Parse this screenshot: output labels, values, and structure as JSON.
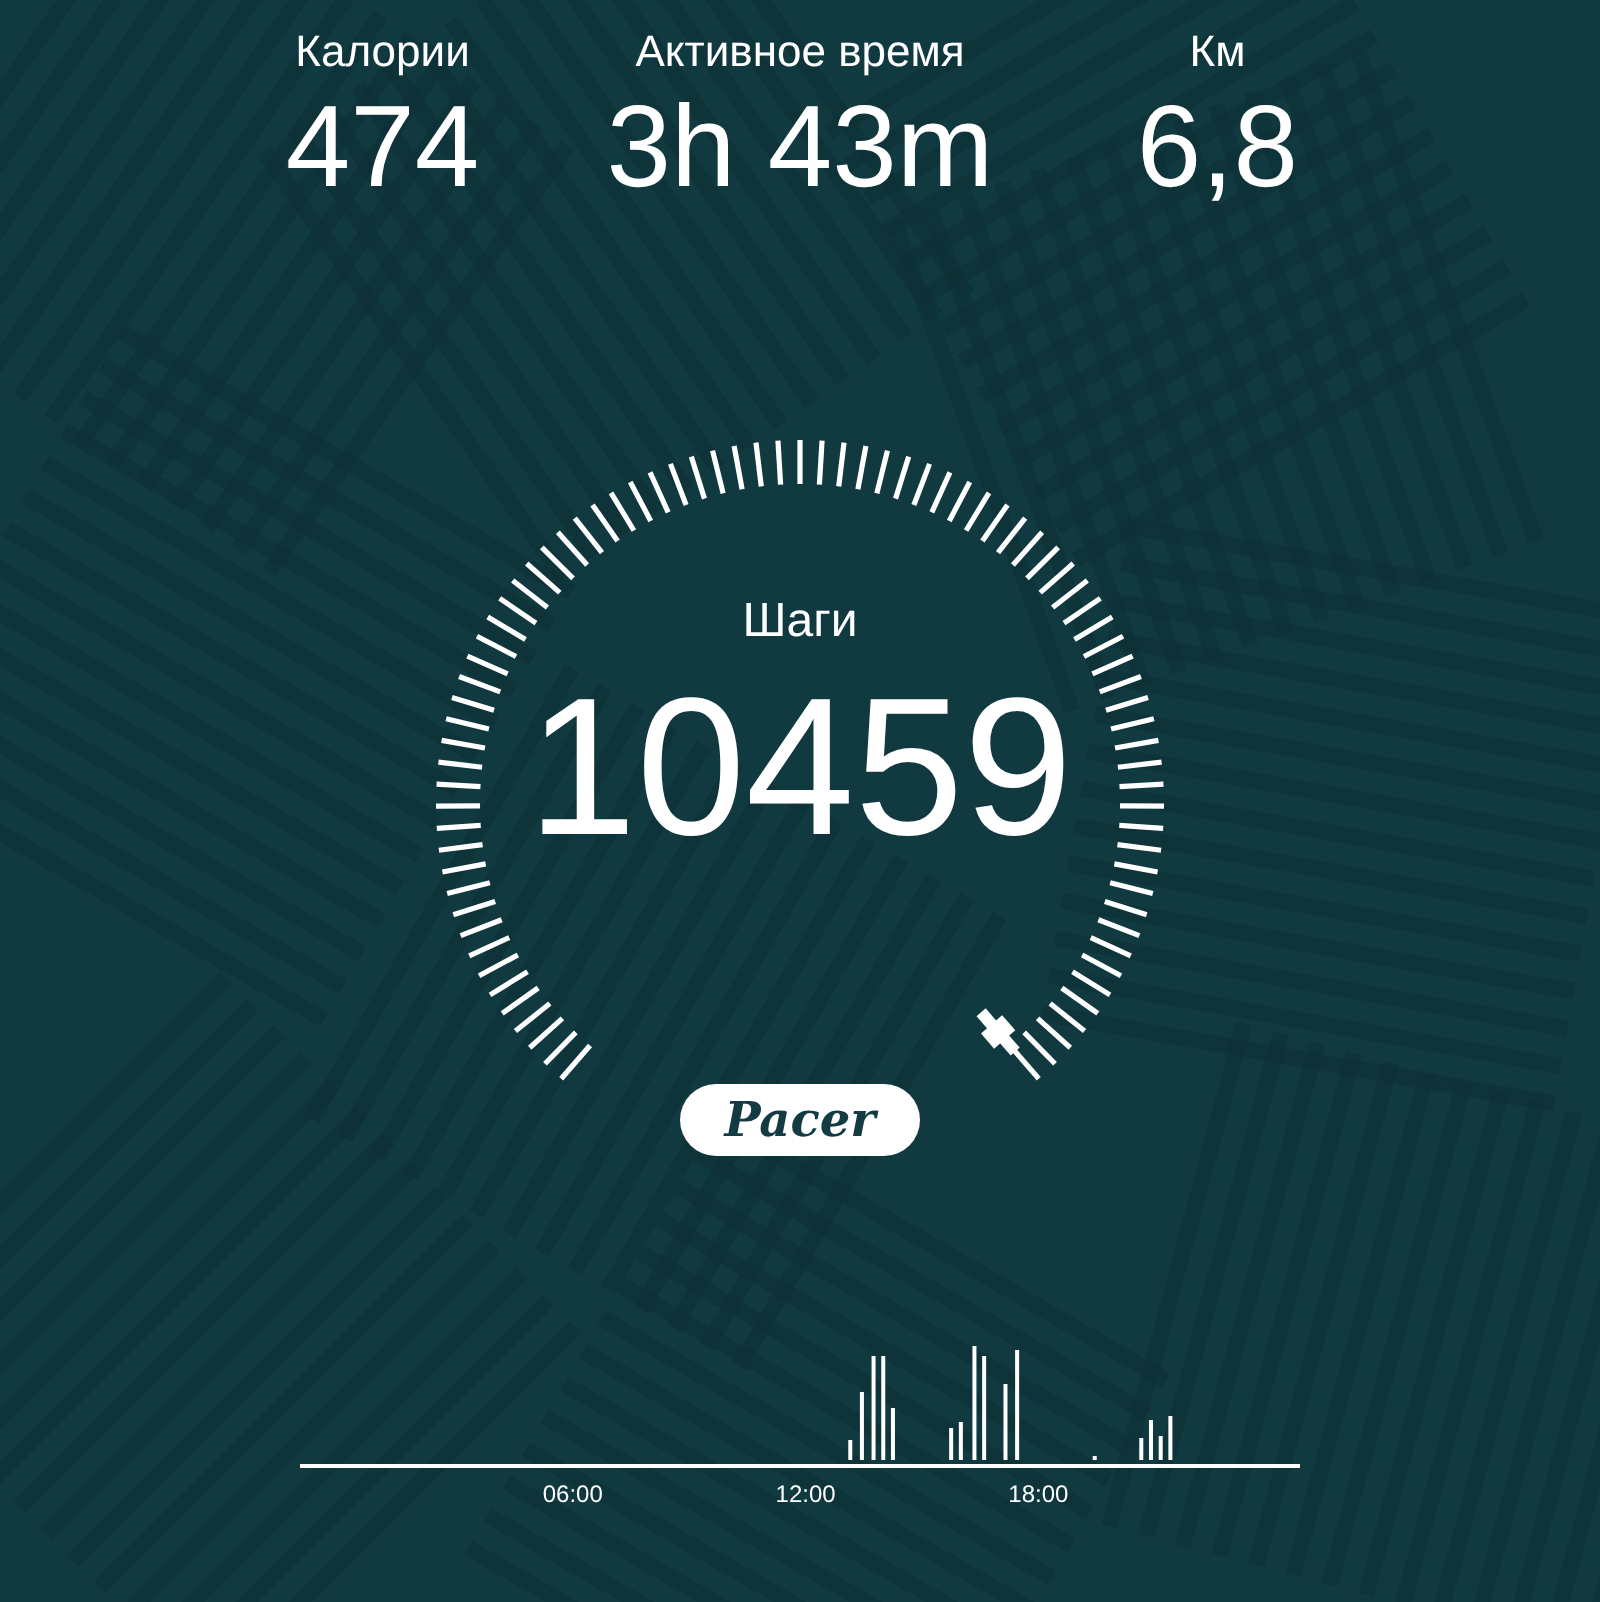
{
  "stats": [
    {
      "label": "Калории",
      "value": "474"
    },
    {
      "label": "Активное время",
      "value": "3h 43m"
    },
    {
      "label": "Км",
      "value": "6,8"
    }
  ],
  "steps": {
    "label": "Шаги",
    "value": "10459"
  },
  "brand": "Pacer",
  "timeline": {
    "ticks": [
      "06:00",
      "12:00",
      "18:00"
    ]
  }
}
